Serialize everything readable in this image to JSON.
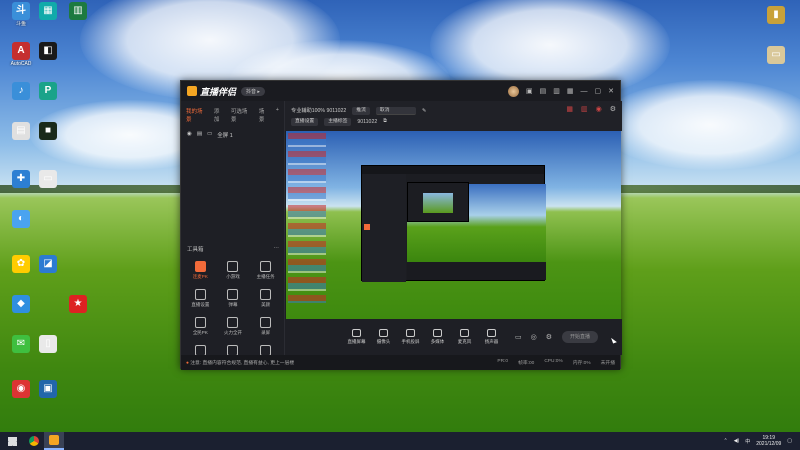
{
  "desktop": {
    "icons_left": [
      {
        "label": "斗鱼",
        "color": "#3a8fd9",
        "glyph": "斗"
      },
      {
        "label": "AutoCAD",
        "color": "#c52f2f",
        "glyph": "A"
      },
      {
        "label": "",
        "color": "#3a8fd9",
        "glyph": "♪"
      },
      {
        "label": "",
        "color": "#e0e0e0",
        "glyph": "▤"
      },
      {
        "label": "",
        "color": "#2d7fd3",
        "glyph": "✚"
      },
      {
        "label": "",
        "color": "#4aa3f0",
        "glyph": "◐"
      },
      {
        "label": "",
        "color": "#ffcc00",
        "glyph": "✿"
      },
      {
        "label": "",
        "color": "#2f8fe0",
        "glyph": "◆"
      },
      {
        "label": "",
        "color": "#3fbf3f",
        "glyph": "✉"
      },
      {
        "label": "",
        "color": "#d33",
        "glyph": "◉"
      },
      {
        "label": "",
        "color": "#1aa",
        "glyph": "▦"
      },
      {
        "label": "",
        "color": "#1a1a1a",
        "glyph": "◧"
      },
      {
        "label": "",
        "color": "#1aa38a",
        "glyph": "P"
      },
      {
        "label": "",
        "color": "#1a2a1a",
        "glyph": "■"
      },
      {
        "label": "",
        "color": "#e9e9e9",
        "glyph": "▭"
      },
      {
        "label": "",
        "color": "#2c7bd2",
        "glyph": "◪"
      },
      {
        "label": "",
        "color": "#e9e9e9",
        "glyph": "▯"
      },
      {
        "label": "",
        "color": "#26a",
        "glyph": "▣"
      },
      {
        "label": "",
        "color": "#1d7a40",
        "glyph": "▥"
      },
      {
        "label": "",
        "color": "#d22",
        "glyph": "★"
      }
    ],
    "icons_right": [
      {
        "label": "",
        "color": "#c8a13a",
        "glyph": "▮"
      },
      {
        "label": "",
        "color": "#d9c89a",
        "glyph": "▭"
      }
    ]
  },
  "window": {
    "brand": "直播伴侣",
    "badge": "抖音 ▸",
    "title_icons": [
      "shirt-icon",
      "gift-icon",
      "chat-icon",
      "layout-icon"
    ],
    "left_tabs": [
      "我的场景",
      "添加",
      "可选场景",
      "场景"
    ],
    "scene_name": "全屏 1",
    "info": {
      "row1": {
        "text": "专业辅助100% 9011022",
        "pill1": "推流",
        "pill2": "取消"
      },
      "row2": {
        "text": "",
        "pill1": "直播设置",
        "pill2": "主播标签",
        "id": "9011022"
      }
    },
    "tools_header": "工具箱",
    "tools": [
      {
        "label": "连麦PK",
        "hot": true
      },
      {
        "label": "小游戏",
        "hot": false
      },
      {
        "label": "主播任务",
        "hot": false
      },
      {
        "label": "直播设置",
        "hot": false
      },
      {
        "label": "弹幕",
        "hot": false
      },
      {
        "label": "美颜",
        "hot": false
      },
      {
        "label": "全民PK",
        "hot": false
      },
      {
        "label": "火力全开",
        "hot": false
      },
      {
        "label": "录屏",
        "hot": false
      },
      {
        "label": "",
        "hot": false
      },
      {
        "label": "",
        "hot": false
      },
      {
        "label": "",
        "hot": false
      }
    ],
    "controls": [
      {
        "label": "直播屏幕"
      },
      {
        "label": "摄像头"
      },
      {
        "label": "手机投屏"
      },
      {
        "label": "多媒体"
      },
      {
        "label": "麦克风"
      },
      {
        "label": "扬声器"
      }
    ],
    "live_button": "开始直播",
    "status": {
      "notice": "注意: 直播内容符合规范, 直播有益心, 更上一层楼",
      "stats": [
        "PR:0",
        "帧率:00",
        "CPU:0%",
        "内存:0%",
        "未开播"
      ]
    }
  },
  "taskbar": {
    "time": "19:19",
    "date": "2021/12/09",
    "tray_icons": [
      "chevron-up-icon",
      "volume-icon",
      "ime-icon",
      "notification-icon"
    ]
  }
}
